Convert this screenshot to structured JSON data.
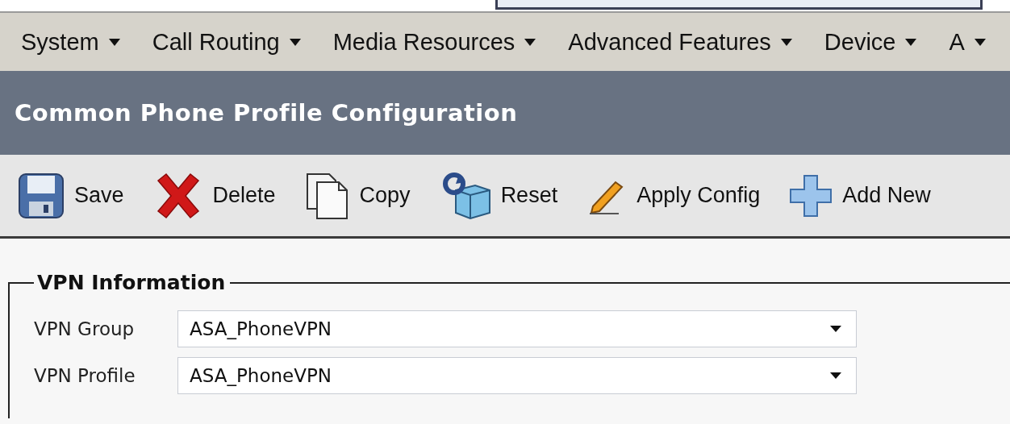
{
  "menu": [
    {
      "label": "System"
    },
    {
      "label": "Call Routing"
    },
    {
      "label": "Media Resources"
    },
    {
      "label": "Advanced Features"
    },
    {
      "label": "Device"
    },
    {
      "label": "A"
    }
  ],
  "page_title": "Common Phone Profile Configuration",
  "toolbar": [
    {
      "kind": "save",
      "label": "Save"
    },
    {
      "kind": "delete",
      "label": "Delete"
    },
    {
      "kind": "copy",
      "label": "Copy"
    },
    {
      "kind": "reset",
      "label": "Reset"
    },
    {
      "kind": "apply",
      "label": "Apply Config"
    },
    {
      "kind": "add",
      "label": "Add New"
    }
  ],
  "section": {
    "legend": "VPN Information",
    "fields": [
      {
        "label": "VPN Group",
        "value": "ASA_PhoneVPN"
      },
      {
        "label": "VPN Profile",
        "value": "ASA_PhoneVPN"
      }
    ]
  }
}
